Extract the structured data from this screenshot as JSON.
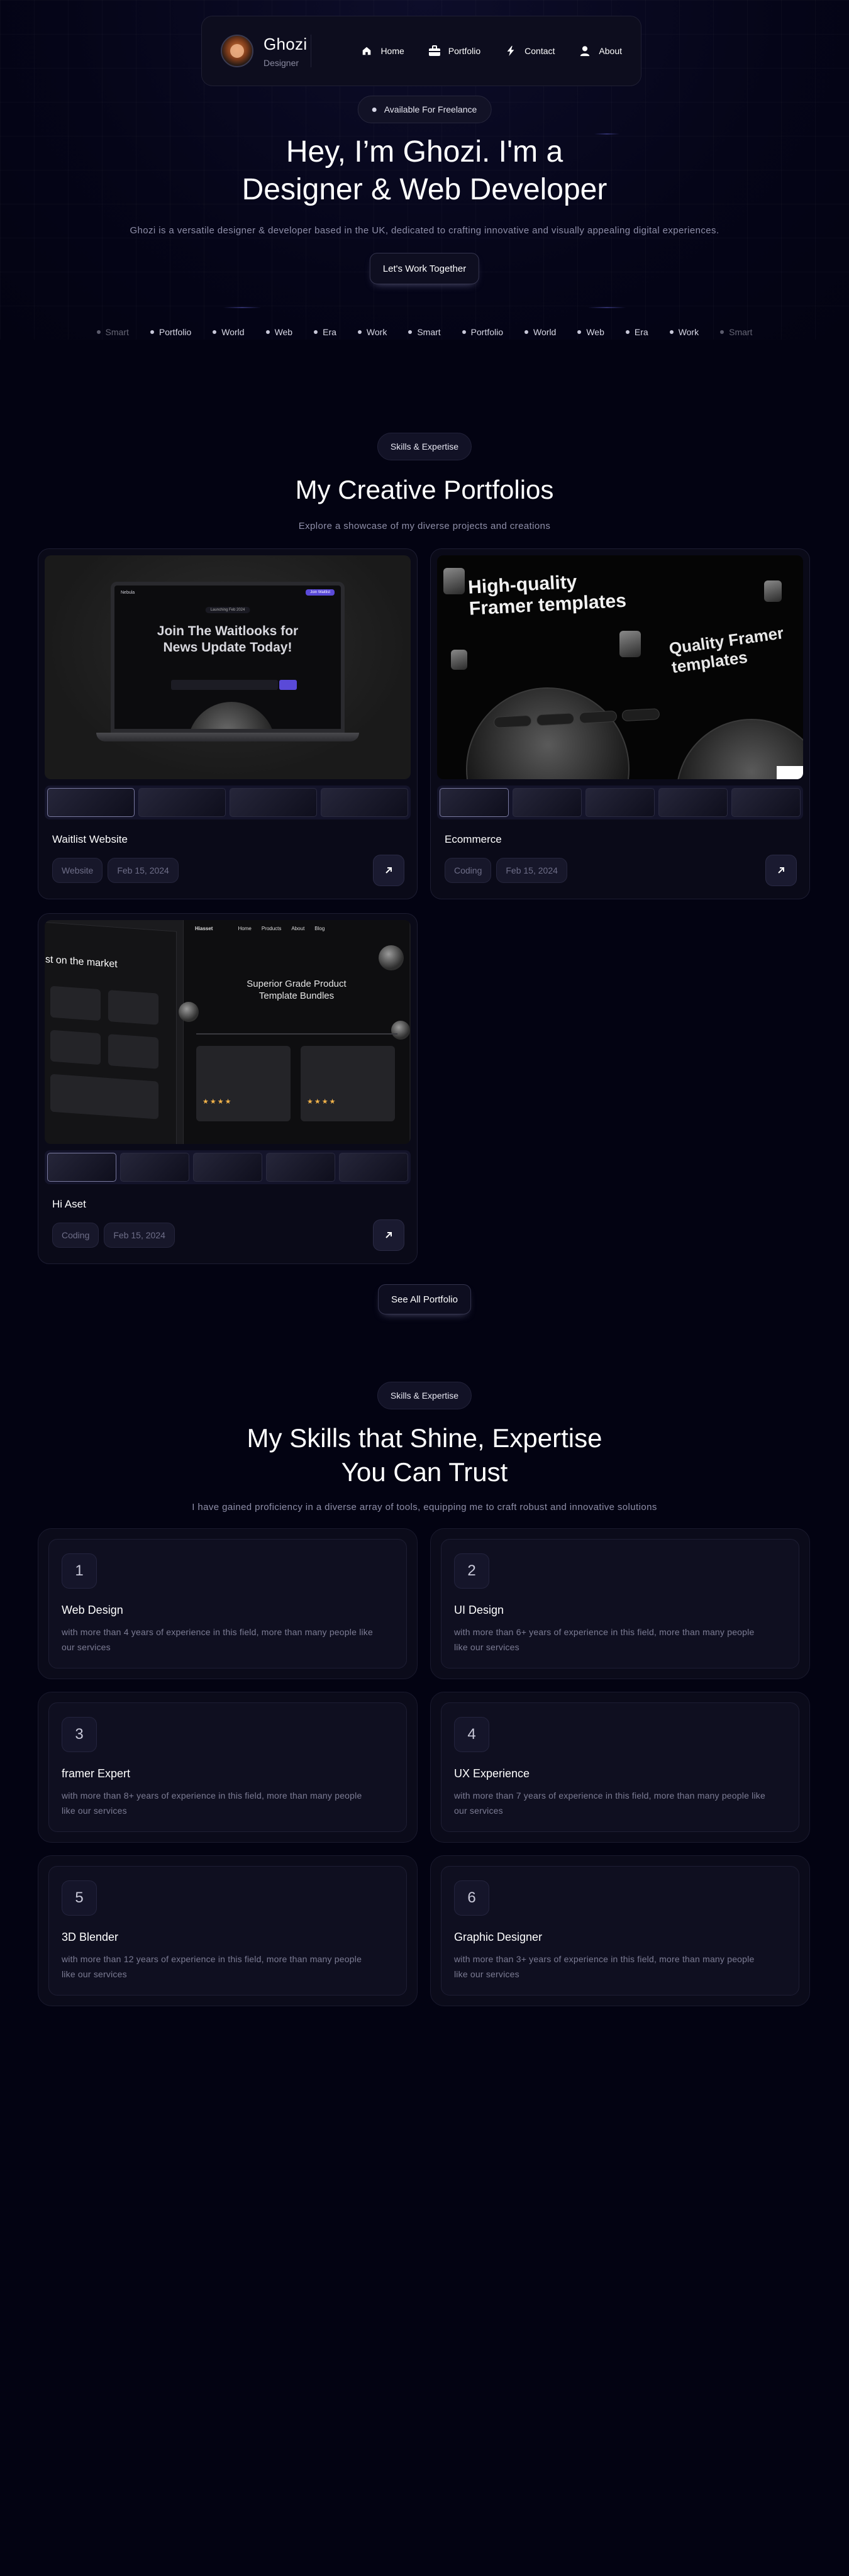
{
  "nav": {
    "name": "Ghozi",
    "role": "Designer",
    "links": [
      {
        "label": "Home",
        "icon": "home-icon"
      },
      {
        "label": "Portfolio",
        "icon": "briefcase-icon"
      },
      {
        "label": "Contact",
        "icon": "phone-icon"
      },
      {
        "label": "About",
        "icon": "user-icon"
      }
    ]
  },
  "hero": {
    "badge": "Available For Freelance",
    "title_line1": "Hey, I’m Ghozi. I'm a",
    "title_line2": "Designer & Web Developer",
    "subtitle": "Ghozi is a versatile designer & developer based in the UK, dedicated to crafting innovative and visually appealing digital experiences.",
    "cta": "Let's Work Together"
  },
  "marquee": [
    "Smart",
    "Portfolio",
    "World",
    "Web",
    "Era",
    "Work",
    "Smart",
    "Portfolio",
    "World",
    "Web",
    "Era",
    "Work",
    "Smart"
  ],
  "portfolio": {
    "badge": "Skills & Expertise",
    "title": "My Creative Portfolios",
    "subtitle": "Explore a showcase of my diverse projects and creations",
    "cards": [
      {
        "title": "Waitlist Website",
        "tags": [
          "Website",
          "Feb 15, 2024"
        ],
        "preview": {
          "brand": "Nebula",
          "button": "Join Waitlist",
          "pill": "Launching Feb 2024",
          "headline_1": "Join The Waitlooks for",
          "headline_2": "News Update Today!"
        }
      },
      {
        "title": "Ecommerce",
        "tags": [
          "Coding",
          "Feb 15, 2024"
        ],
        "preview": {
          "headline": "High-quality Framer templates",
          "headline_echo": "Quality Framer templates"
        }
      },
      {
        "title": "Hi Aset",
        "tags": [
          "Coding",
          "Feb 15, 2024"
        ],
        "preview": {
          "brand": "Hiasset",
          "nav": [
            "Home",
            "Products",
            "About",
            "Blog"
          ],
          "headline": "Superior Grade Product Template Bundles",
          "left_title": "st on the market"
        }
      }
    ],
    "see_all": "See All Portfolio"
  },
  "skills": {
    "badge": "Skills & Expertise",
    "title_line1": "My Skills that Shine,  Expertise",
    "title_line2": "You Can Trust",
    "subtitle": "I have gained proficiency in a diverse array of tools, equipping me to craft robust and innovative solutions",
    "cards": [
      {
        "num": "1",
        "title": "Web Design",
        "desc": "with more than 4 years of experience in this field, more than many people like our services"
      },
      {
        "num": "2",
        "title": "UI Design",
        "desc": "with more than 6+ years of experience in this field, more than many people like our services"
      },
      {
        "num": "3",
        "title": "framer Expert",
        "desc": "with more than 8+ years of experience in this field, more than many people like our services"
      },
      {
        "num": "4",
        "title": "UX Experience",
        "desc": "with more than 7 years of experience in this field, more than many people like our services"
      },
      {
        "num": "5",
        "title": "3D Blender",
        "desc": "with more than 12 years of experience in this field, more than many people like our services"
      },
      {
        "num": "6",
        "title": "Graphic Designer",
        "desc": "with more than 3+ years of experience in this field, more than many people like our services"
      }
    ]
  },
  "colors": {
    "background": "#030312",
    "card": "#0a0a18",
    "accent": "#5a4ad8"
  }
}
